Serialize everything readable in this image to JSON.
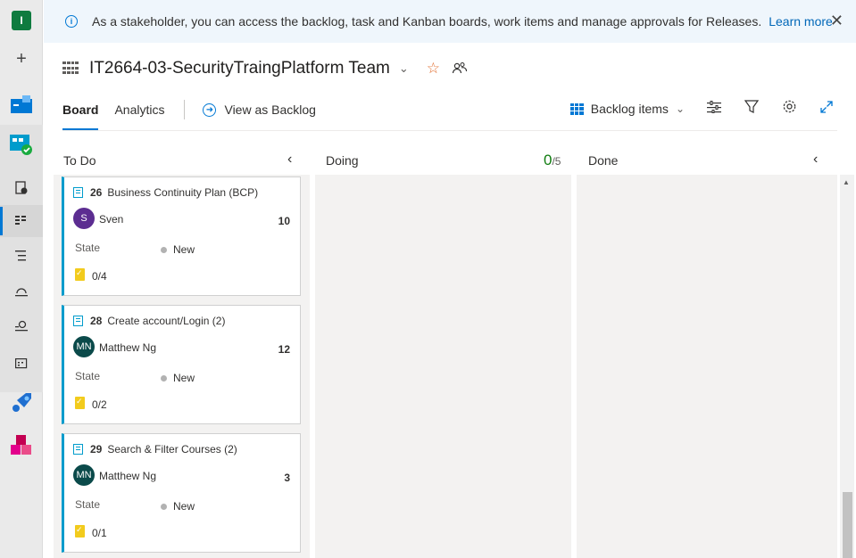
{
  "org": {
    "initial": "I"
  },
  "banner": {
    "text": "As a stakeholder, you can access the backlog, task and Kanban boards, work items and manage approvals for Releases.",
    "link": "Learn more"
  },
  "header": {
    "team_title": "IT2664-03-SecurityTraingPlatform Team"
  },
  "tabs": {
    "board": "Board",
    "analytics": "Analytics",
    "view_as_backlog": "View as Backlog"
  },
  "toolbar": {
    "level": "Backlog items"
  },
  "columns": [
    {
      "name": "To Do"
    },
    {
      "name": "Doing",
      "wip_current": "0",
      "wip_limit": "/5"
    },
    {
      "name": "Done"
    }
  ],
  "cards": [
    {
      "id": "26",
      "title": "Business Continuity Plan (BCP)",
      "avatar_initials": "S",
      "avatar_color": "#5c2d91",
      "assignee": "Sven",
      "points": "10",
      "state_label": "State",
      "state": "New",
      "tasks": "0/4"
    },
    {
      "id": "28",
      "title": "Create account/Login (2)",
      "avatar_initials": "MN",
      "avatar_color": "#0b4a4a",
      "assignee": "Matthew Ng",
      "points": "12",
      "state_label": "State",
      "state": "New",
      "tasks": "0/2"
    },
    {
      "id": "29",
      "title": "Search & Filter Courses (2)",
      "avatar_initials": "MN",
      "avatar_color": "#0b4a4a",
      "assignee": "Matthew Ng",
      "points": "3",
      "state_label": "State",
      "state": "New",
      "tasks": "0/1"
    }
  ],
  "colors": {
    "accent": "#0078d4",
    "card_border": "#009ccc",
    "wip": "#107c10",
    "favorite": "#e16b2c"
  }
}
